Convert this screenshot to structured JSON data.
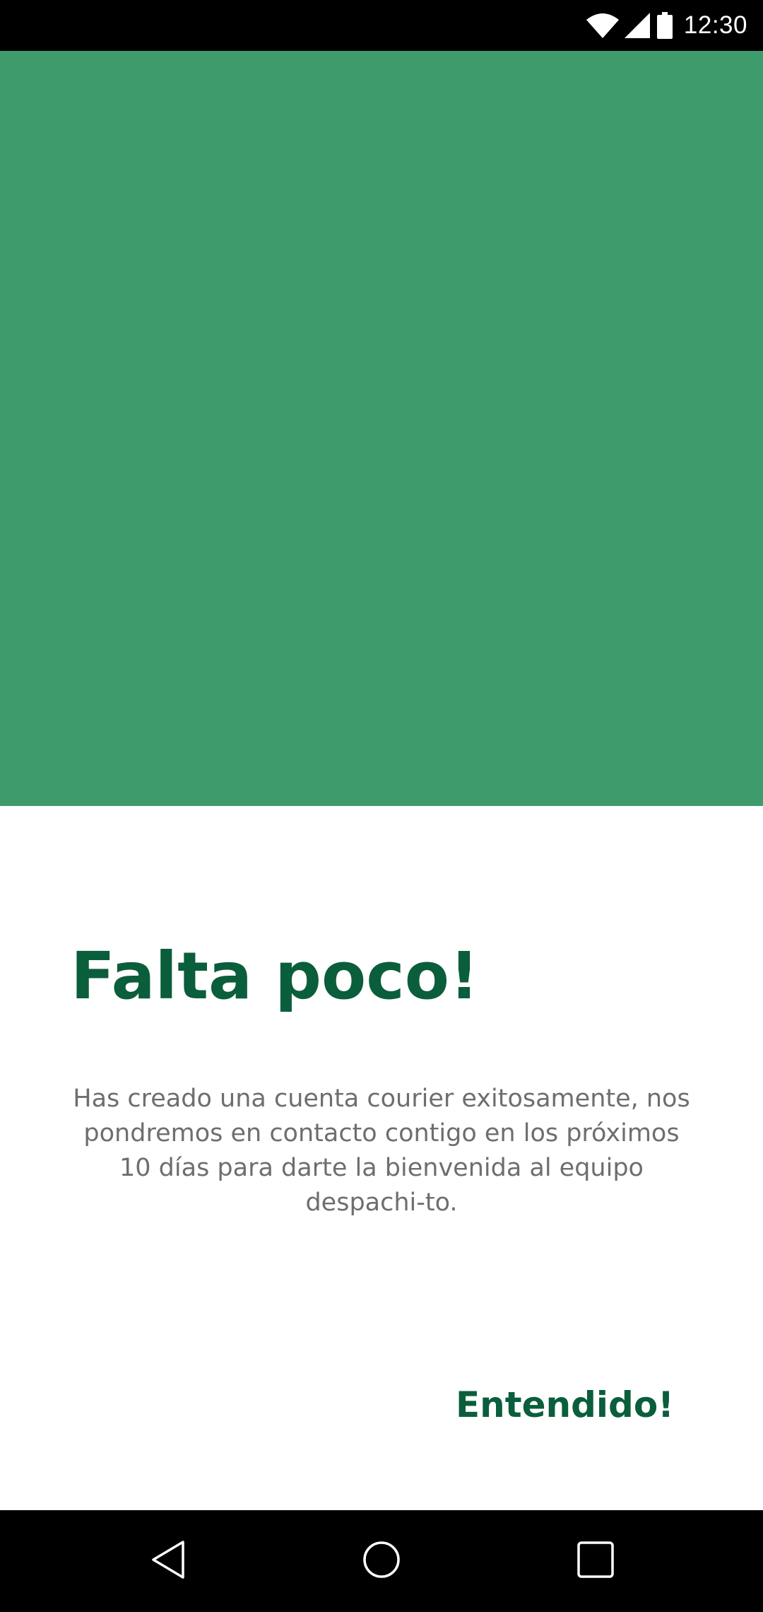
{
  "status_bar": {
    "time": "12:30",
    "icons": [
      "wifi-icon",
      "cellular-signal-icon",
      "battery-icon"
    ]
  },
  "hero": {
    "color": "#3e9c6c"
  },
  "dialog": {
    "title": "Falta poco!",
    "message": "Has creado una cuenta courier exitosamente, nos pondremos en contacto contigo en los próximos 10 días para darte la bienvenida al equipo despachi-to.",
    "confirm_label": "Entendido!",
    "accent_color": "#0b5e3b"
  },
  "nav_bar": {
    "buttons": [
      "back-icon",
      "home-icon",
      "recents-icon"
    ]
  }
}
